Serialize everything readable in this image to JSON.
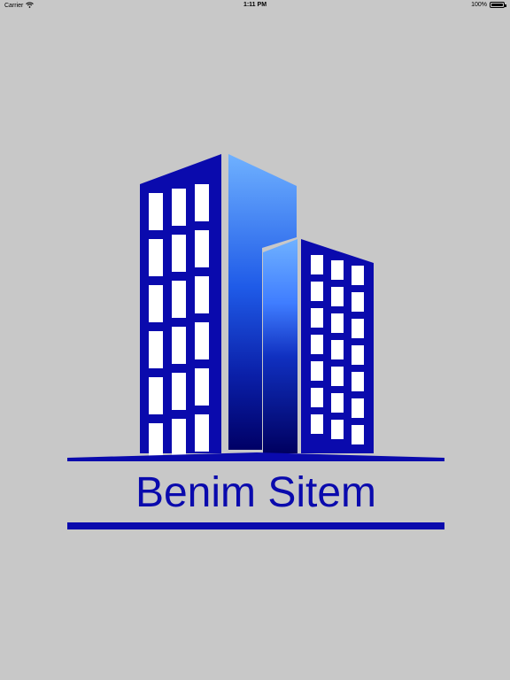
{
  "status_bar": {
    "carrier": "Carrier",
    "time": "1:11 PM",
    "battery_percent_text": "100%",
    "battery_level": 1.0,
    "wifi_icon": "wifi-icon",
    "battery_icon": "battery-icon"
  },
  "logo": {
    "brand_name": "Benim Sitem",
    "icon": "buildings-logo",
    "colors": {
      "primary": "#0a0aad",
      "light_blue": "#6fb1ff",
      "dark_blue": "#000066",
      "background": "#c8c8c8"
    }
  }
}
